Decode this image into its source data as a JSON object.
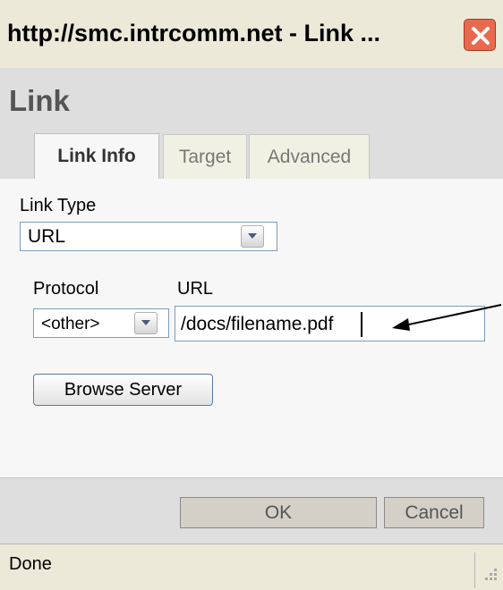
{
  "window": {
    "title": "http://smc.intrcomm.net - Link ...",
    "close_icon": "close-icon"
  },
  "dialog": {
    "heading": "Link",
    "tabs": [
      {
        "label": "Link Info",
        "active": true
      },
      {
        "label": "Target",
        "active": false
      },
      {
        "label": "Advanced",
        "active": false
      }
    ]
  },
  "form": {
    "link_type_label": "Link Type",
    "link_type_value": "URL",
    "protocol_label": "Protocol",
    "protocol_value": "<other>",
    "url_label": "URL",
    "url_value": "/docs/filename.pdf",
    "browse_label": "Browse Server"
  },
  "buttons": {
    "ok_label": "OK",
    "cancel_label": "Cancel"
  },
  "status": {
    "text": "Done"
  },
  "colors": {
    "titlebar": "#ece9d8",
    "close_button": "#e9694f",
    "input_border": "#7f9db9",
    "heading_text": "#555555"
  }
}
